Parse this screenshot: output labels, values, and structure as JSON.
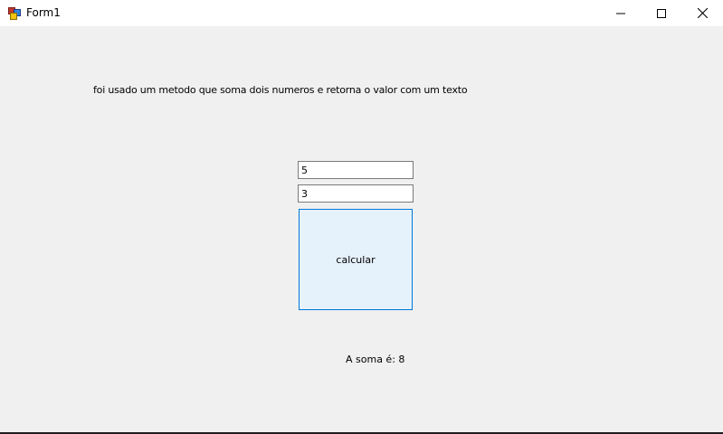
{
  "window": {
    "title": "Form1",
    "app_icon": "winforms-app-icon",
    "controls": {
      "minimize_icon": "minimize-icon",
      "maximize_icon": "maximize-icon",
      "close_icon": "close-icon"
    }
  },
  "form": {
    "description": "foi usado um metodo que soma dois numeros e retorna o valor com um texto",
    "input1_value": "5",
    "input2_value": "3",
    "calculate_label": "calcular",
    "result_text": "A soma é: 8"
  },
  "colors": {
    "background": "#f0f0f0",
    "button_border": "#0078d7",
    "button_fill": "#e5f1fb"
  }
}
